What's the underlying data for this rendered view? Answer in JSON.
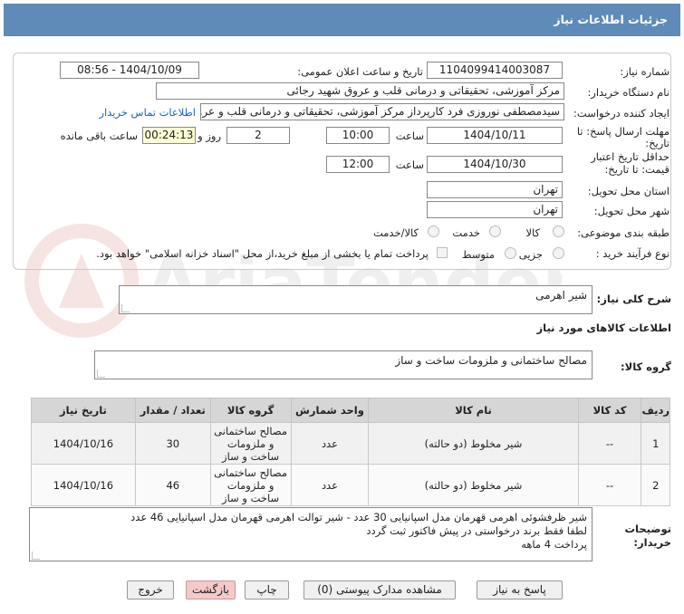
{
  "header": {
    "title": "جزئیات اطلاعات نیاز"
  },
  "form": {
    "need_number_label": "شماره نیاز:",
    "need_number": "1104099414003087",
    "announce_label": "تاریخ و ساعت اعلان عمومی:",
    "announce_value": "1404/10/09 - 08:56",
    "buyer_label": "نام دستگاه خریدار:",
    "buyer_value": "مرکز آموزشی، تحقیقاتی و درمانی قلب و عروق شهید رجائی",
    "creator_label": "ایجاد کننده درخواست:",
    "creator_value": "سیدمصطفی نوروزی فرد کارپرداز مرکز آموزشی، تحقیقاتی و درمانی قلب و عروق",
    "contact_link": "اطلاعات تماس خریدار",
    "deadline_label_1": "مهلت ارسال پاسخ: تا",
    "deadline_label_2": "تاریخ:",
    "deadline_date": "1404/10/11",
    "time_label": "ساعت",
    "deadline_time": "10:00",
    "days_value": "2",
    "days_label": "روز و",
    "remaining_value": "00:24:13",
    "remaining_label": "ساعت باقی مانده",
    "validity_label_1": "حداقل تاریخ اعتبار",
    "validity_label_2": "قیمت: تا تاریخ:",
    "validity_date": "1404/10/30",
    "validity_time": "12:00",
    "province_label": "استان محل تحویل:",
    "province_value": "تهران",
    "city_label": "شهر محل تحویل:",
    "city_value": "تهران",
    "category_label": "طبقه بندی موضوعی:",
    "category_options": [
      "کالا",
      "خدمت",
      "کالا/خدمت"
    ],
    "process_label": "نوع فرآیند خرید :",
    "process_options": [
      "جزیی",
      "متوسط"
    ],
    "payment_note": "پرداخت تمام یا بخشی از مبلغ خرید،از محل \"اسناد خزانه اسلامی\" خواهد بود."
  },
  "summary": {
    "label": "شرح کلی نیاز:",
    "value": "شیر اهرمی"
  },
  "goods_info": {
    "heading": "اطلاعات کالاهای مورد نیاز",
    "group_label": "گروه کالا:",
    "group_value": "مصالح ساختمانی و ملزومات ساخت و ساز"
  },
  "table": {
    "headers": [
      "ردیف",
      "کد کالا",
      "نام کالا",
      "واحد شمارش",
      "گروه کالا",
      "تعداد / مقدار",
      "تاریخ نیاز"
    ],
    "rows": [
      {
        "row": "1",
        "code": "--",
        "name": "شیر مخلوط (دو حالته)",
        "unit": "عدد",
        "group": "مصالح ساختمانی و ملزومات ساخت و ساز",
        "qty": "30",
        "date": "1404/10/16"
      },
      {
        "row": "2",
        "code": "--",
        "name": "شیر مخلوط (دو حالته)",
        "unit": "عدد",
        "group": "مصالح ساختمانی و ملزومات ساخت و ساز",
        "qty": "46",
        "date": "1404/10/16"
      }
    ]
  },
  "notes": {
    "label": "توضیحات خریدار:",
    "line1": "شیر ظرفشوئی اهرمی قهرمان مدل اسپانیایی 30 عدد - شیر توالت اهرمی قهرمان مدل اسپانیایی 46 عدد",
    "line2": "لطفا فقط برند درخواستی در پیش فاکتور ثبت گردد",
    "line3": "پرداخت 4 ماهه"
  },
  "buttons": {
    "reply": "پاسخ به نیاز",
    "attachments": "مشاهده مدارک پیوستی (0)",
    "print": "چاپ",
    "back": "بازگشت",
    "exit": "خروج"
  },
  "watermark": {
    "text": "AriaTender.net"
  },
  "colors": {
    "title_bar": "#5f8bb8",
    "highlight_field": "#fefed6",
    "link": "#1565c0",
    "back_button": "#f3c9c9"
  }
}
